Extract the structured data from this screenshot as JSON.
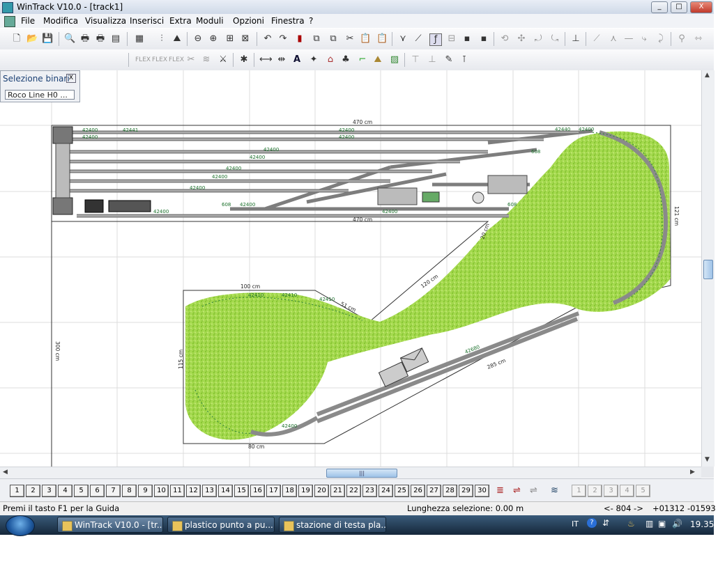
{
  "window": {
    "title": "WinTrack  V10.0 - [track1]",
    "btn_min": "_",
    "btn_max": "□",
    "btn_close": "X"
  },
  "menu": {
    "items": [
      "File",
      "Modifica",
      "Visualizza",
      "Inserisci",
      "Extra",
      "Moduli",
      "Opzioni",
      "Finestra",
      "?"
    ]
  },
  "panel": {
    "title": "Selezione binari",
    "close": "X",
    "selected": "Roco Line H0 ..."
  },
  "layout": {
    "labels": {
      "w470_top": "470 cm",
      "w470_bot": "470 cm",
      "w100": "100 cm",
      "h121": "121 cm",
      "h300": "300 cm",
      "h115": "115 cm",
      "d285": "285 cm",
      "d51": "51 cm",
      "d20": "20 cm",
      "d120": "120 cm",
      "d80": "80 cm"
    },
    "part_numbers": [
      "42400",
      "42400",
      "42441",
      "42400",
      "42400",
      "42400",
      "42400",
      "42400",
      "42440",
      "42400",
      "42400",
      "42400",
      "42400",
      "608",
      "608",
      "608",
      "42400",
      "42400",
      "42680",
      "42400",
      "42410",
      "42410",
      "42410"
    ]
  },
  "layers": [
    "1",
    "2",
    "3",
    "4",
    "5",
    "6",
    "7",
    "8",
    "9",
    "10",
    "11",
    "12",
    "13",
    "14",
    "15",
    "16",
    "17",
    "18",
    "19",
    "20",
    "21",
    "22",
    "23",
    "24",
    "25",
    "26",
    "27",
    "28",
    "29",
    "30"
  ],
  "layer_disabled": [
    "1",
    "2",
    "3",
    "4",
    "5"
  ],
  "status": {
    "help": "Premi il tasto F1 per la Guida",
    "selection": "Lunghezza selezione: 0.00 m",
    "nav": "<- 804 ->",
    "x": "+01312",
    "y": "-01593"
  },
  "taskbar": {
    "tasks": [
      "WinTrack  V10.0 - [tr...",
      "plastico punto a pu...",
      "stazione di testa pla..."
    ],
    "lang": "IT",
    "time": "19.35"
  },
  "colors": {
    "vegetation": "#9fd64a",
    "track": "#8c8c8c",
    "grid": "#d9d9d9",
    "labels": "#1a6f2a"
  }
}
